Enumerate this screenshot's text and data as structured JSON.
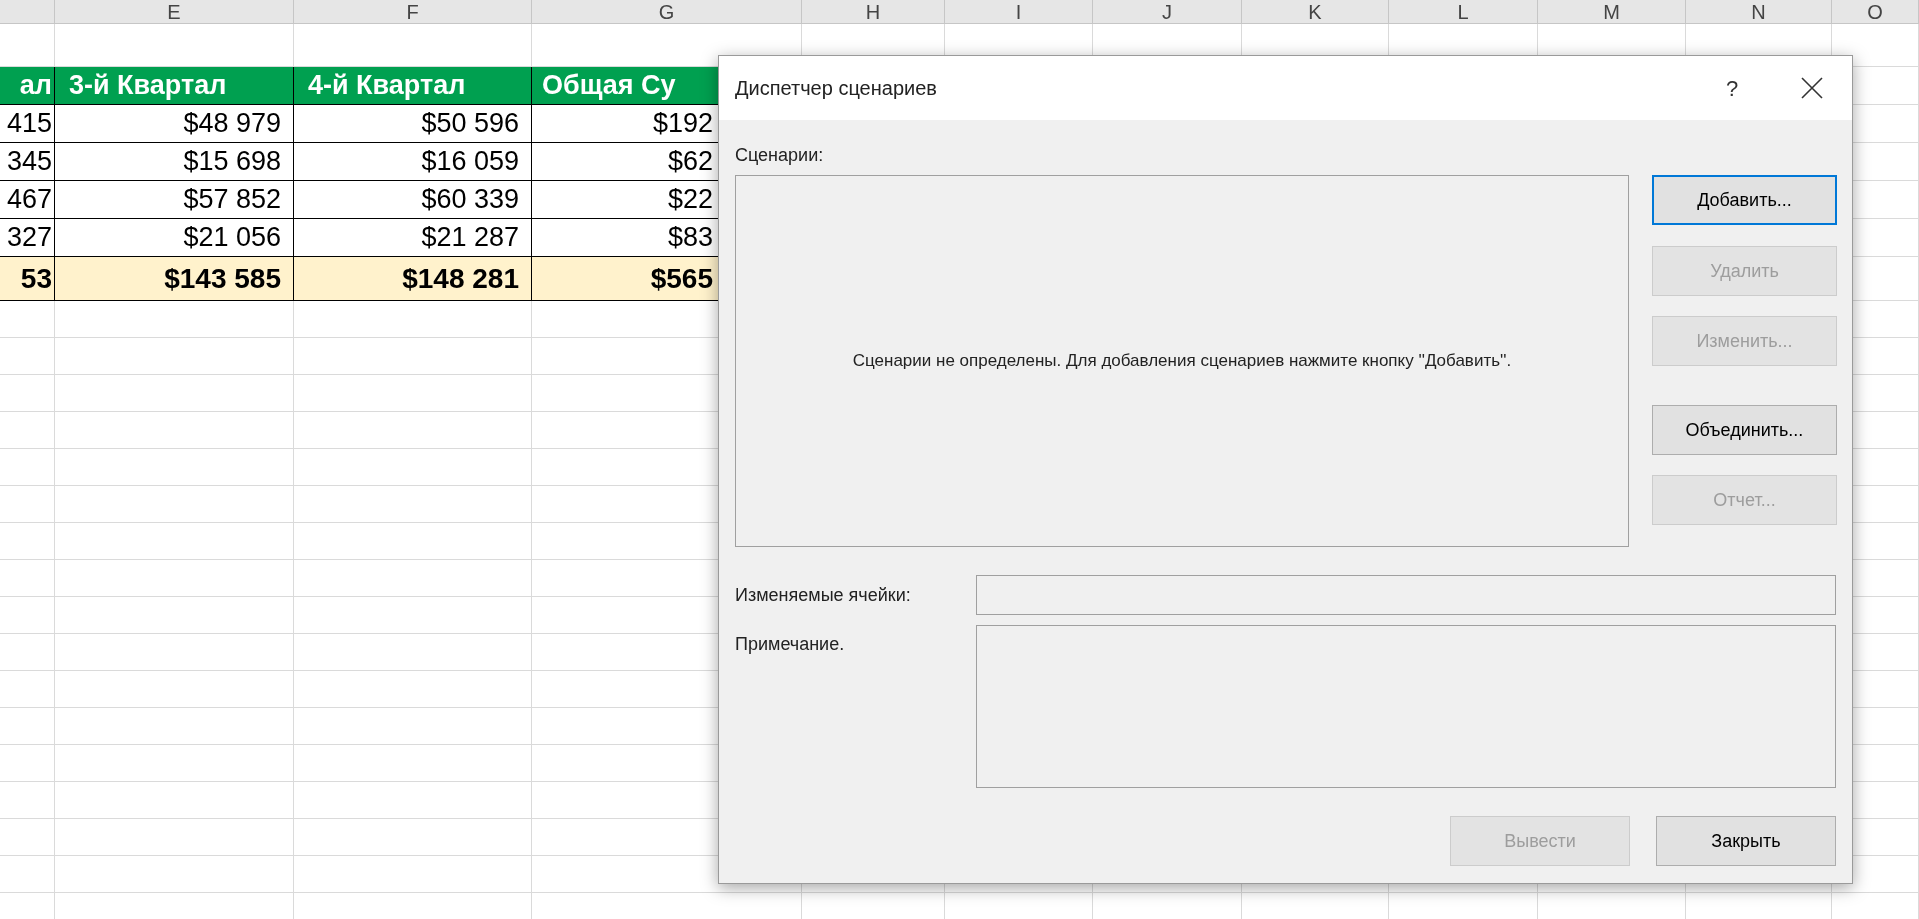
{
  "sheet": {
    "column_headers": [
      "E",
      "F",
      "G",
      "H",
      "I",
      "J",
      "K",
      "L",
      "M",
      "N",
      "O"
    ],
    "header_row": [
      "ал",
      "3-й Квартал",
      "4-й Квартал",
      "Общая Су"
    ],
    "rows": [
      [
        "415",
        "$48 979",
        "$50 596",
        "$192"
      ],
      [
        "345",
        "$15 698",
        "$16 059",
        "$62"
      ],
      [
        "467",
        "$57 852",
        "$60 339",
        "$22"
      ],
      [
        "327",
        "$21 056",
        "$21 287",
        "$83"
      ]
    ],
    "total_row": [
      "53",
      "$143 585",
      "$148 281",
      "$565"
    ]
  },
  "dialog": {
    "title": "Диспетчер сценариев",
    "help": "?",
    "scenarios_label": "Сценарии:",
    "empty_message": "Сценарии не определены. Для добавления сценариев нажмите кнопку ''Добавить''.",
    "side_buttons": [
      {
        "label": "Добавить...",
        "disabled": false,
        "default": true
      },
      {
        "label": "Удалить",
        "disabled": true,
        "default": false
      },
      {
        "label": "Изменить...",
        "disabled": true,
        "default": false
      },
      {
        "label": "Объединить...",
        "disabled": false,
        "default": false
      },
      {
        "label": "Отчет...",
        "disabled": true,
        "default": false
      }
    ],
    "changing_cells_label": "Изменяемые ячейки:",
    "comment_label": "Примечание.",
    "bottom_buttons": [
      {
        "label": "Вывести",
        "disabled": true,
        "default": false
      },
      {
        "label": "Закрыть",
        "disabled": false,
        "default": false
      }
    ]
  }
}
